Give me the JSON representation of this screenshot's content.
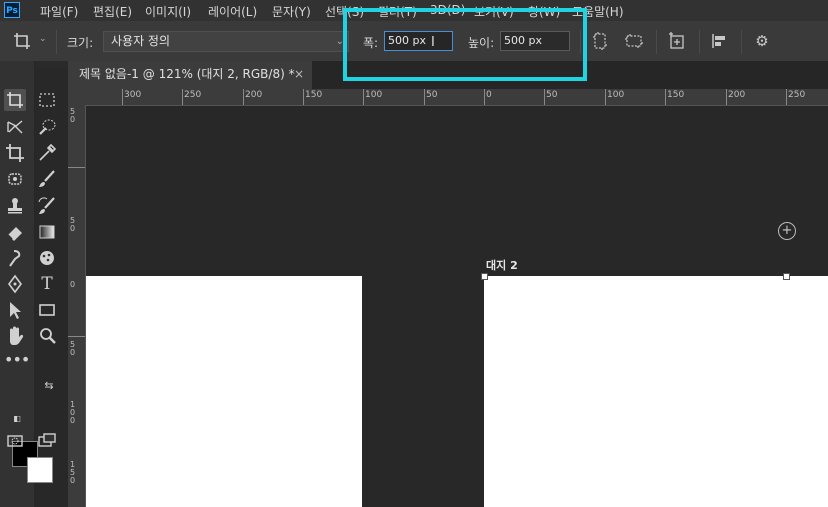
{
  "app": {
    "logo": "Ps"
  },
  "menu": [
    "파일(F)",
    "편집(E)",
    "이미지(I)",
    "레이어(L)",
    "문자(Y)",
    "선택(S)",
    "필터(T)",
    "3D(D)",
    "보기(V)",
    "창(W)",
    "도움말(H)"
  ],
  "options": {
    "size_label": "크기:",
    "preset_value": "사용자 정의",
    "width_label": "폭:",
    "width_value": "500 px",
    "height_label": "높이:",
    "height_value": "500 px"
  },
  "document_tab": {
    "title": "제목 없음-1 @ 121% (대지 2, RGB/8) *",
    "close": "×"
  },
  "ruler": {
    "h_labels": [
      "300",
      "250",
      "200",
      "150",
      "100",
      "50",
      "0",
      "50",
      "100",
      "150",
      "200",
      "250"
    ],
    "v_labels": [
      "5 0",
      "5 0",
      "0",
      "5 0",
      "1 0 0",
      "1 5 0"
    ]
  },
  "artboard": {
    "label": "대지 2"
  },
  "colors": {
    "highlight": "#1fd3e0",
    "foreground": "#000000",
    "background": "#ffffff"
  },
  "icons": {
    "artboard_tool": "artboard-icon",
    "marquee": "marquee-icon",
    "lasso": "lasso-icon",
    "quick_select": "quick-select-icon",
    "crop": "crop-icon",
    "eyedropper": "eyedropper-icon",
    "patch": "patch-icon",
    "brush": "brush-icon",
    "stamp": "stamp-icon",
    "history_brush": "history-brush-icon",
    "eraser": "eraser-icon",
    "gradient": "gradient-icon",
    "smudge": "smudge-icon",
    "sponge": "sponge-icon",
    "pen": "pen-icon",
    "type": "type-icon",
    "path_select": "path-select-icon",
    "rectangle": "rectangle-icon",
    "hand": "hand-icon",
    "zoom": "zoom-icon",
    "more": "more-icon",
    "settings": "gear-icon"
  }
}
